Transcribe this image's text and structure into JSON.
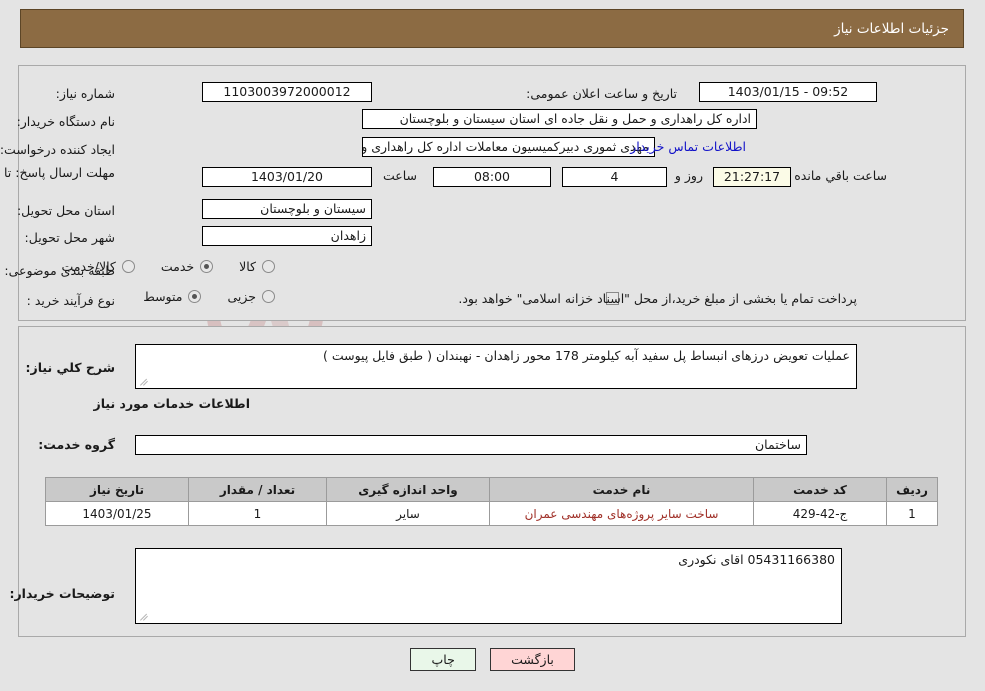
{
  "window": {
    "title": "جزئیات اطلاعات نیاز"
  },
  "colors": {
    "header_bg": "#8c6b43",
    "header_text": "#ffffff",
    "page_bg": "#e4e4e4",
    "link": "#1212c8",
    "service_name_text": "#a03028",
    "table_header_bg": "#c9c9c9",
    "countdown_bg": "#fbfbe7",
    "print_button_bg": "#e9f7e9",
    "back_button_bg": "#ffd5d5"
  },
  "watermark": {
    "text": "AriaTender.net"
  },
  "top_form": {
    "need_number": {
      "label": "شماره نیاز:",
      "value": "1103003972000012"
    },
    "announce_datetime": {
      "label": "تاریخ و ساعت اعلان عمومی:",
      "value": "09:52 - 1403/01/15"
    },
    "buyer_org": {
      "label": "نام دستگاه خریدار:",
      "value": "اداره کل راهداری و حمل و نقل جاده ای استان سیستان و بلوچستان"
    },
    "request_creator": {
      "label": "ایجاد کننده درخواست:",
      "value": "مهدی ثموری دبیرکمیسیون معاملات اداره کل راهداری و حمل و نقل جاده ای است",
      "contact_link": "اطلاعات تماس خریدار"
    },
    "response_deadline": {
      "label": "مهلت ارسال پاسخ: تا تاریخ:",
      "date": "1403/01/20",
      "time_label": "ساعت",
      "time": "08:00",
      "days": "4",
      "days_label": "روز و",
      "countdown": "21:27:17",
      "countdown_label": "ساعت باقي مانده"
    },
    "delivery_province": {
      "label": "استان محل تحویل:",
      "value": "سیستان و بلوچستان"
    },
    "delivery_city": {
      "label": "شهر محل تحویل:",
      "value": "زاهدان"
    },
    "subject_classification": {
      "label": "طبقه بندی موضوعی:",
      "options": [
        "کالا",
        "خدمت",
        "کالا/خدمت"
      ],
      "selected": "خدمت"
    },
    "purchase_process_type": {
      "label": "نوع فرآیند خرید :",
      "options": [
        "جزیی",
        "متوسط"
      ],
      "selected": "متوسط",
      "checkbox_label": "پرداخت تمام یا بخشی از مبلغ خرید،از محل \"اسناد خزانه اسلامی\" خواهد بود.",
      "checkbox_checked": false
    }
  },
  "bottom_form": {
    "general_description": {
      "label": "شرح کلي نیاز:",
      "value": "عملیات تعویض درزهای انبساط پل سفید آبه کیلومتر 178 محور زاهدان - نهبندان ( طبق فایل پیوست )"
    },
    "services_section_heading": "اطلاعات خدمات مورد نیاز",
    "service_group": {
      "label": "گروه خدمت:",
      "value": "ساختمان"
    },
    "services_table": {
      "headers": [
        "ردیف",
        "کد خدمت",
        "نام خدمت",
        "واحد اندازه گیری",
        "تعداد / مقدار",
        "تاریخ نیاز"
      ],
      "rows": [
        {
          "index": "1",
          "service_code": "ج-42-429",
          "service_name": "ساخت سایر پروژه‌های مهندسی عمران",
          "unit": "سایر",
          "quantity": "1",
          "need_date": "1403/01/25"
        }
      ]
    },
    "buyer_notes": {
      "label": "توضیحات خریدار:",
      "value": "05431166380 اقای نکودری"
    }
  },
  "buttons": {
    "print": "چاپ",
    "back": "بازگشت"
  }
}
